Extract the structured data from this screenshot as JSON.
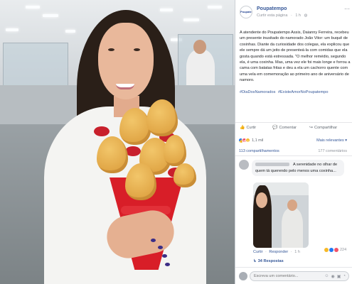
{
  "post": {
    "page_name": "Poupatempo",
    "avatar_text": "Poupatempo",
    "follow_label": "Curtir esta página",
    "time": "1 h",
    "more_icon": "more-dots-icon",
    "text": "A atendente do Poupatempo Assis, Daianny Ferreira, recebeu um presente inusitado do namorado João Vitor: um buquê de coxinhas. Diante da curiosidade dos colegas, ela explicou que ele sempre dá um jeito de presenteá-la com comidas que ela gosta quando está estressada. \"O melhor remédio, segundo ela, é uma coxinha. Mas, uma vez ele foi mais longe e forrou a cama com batatas fritas e deu a ela um cachorro quente com uma vela em comemoração ao primeiro ano de aniversário de namoro.",
    "hashtags": [
      "#DiaDosNamorados",
      "#ExisteAmorNoPoupatempo"
    ]
  },
  "actions": {
    "like": "Curtir",
    "comment": "Comentar",
    "share": "Compartilhar"
  },
  "reactions": {
    "count": "1,1 mil",
    "relevant_label": "Mais relevantes"
  },
  "stats": {
    "shares": "113 compartilhamentos",
    "comments": "177 comentários"
  },
  "comment": {
    "text": "A serenidade no olhar de quem tá querendo pelo menos uma coxinha...",
    "like_label": "Curtir",
    "reply_label": "Responder",
    "time": "1 h",
    "reaction_count": "224",
    "replies_label": "34 Respostas"
  },
  "composer": {
    "placeholder": "Escreva um comentário..."
  },
  "colors": {
    "link": "#365899",
    "like": "#2078f4",
    "love": "#f25268",
    "haha": "#f7b928",
    "bouquet": "#d81e28"
  }
}
